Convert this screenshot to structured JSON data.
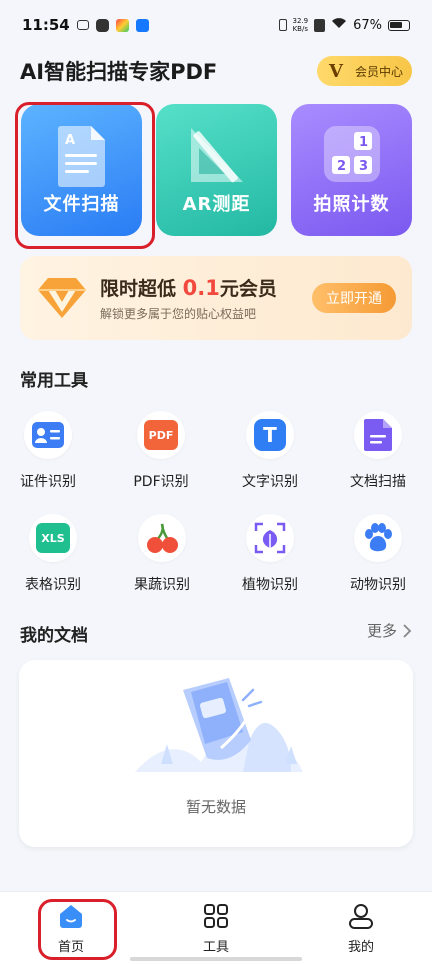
{
  "status_bar": {
    "time": "11:54",
    "net_top": "32.9",
    "net_bottom": "KB/s",
    "battery": "67%"
  },
  "header": {
    "title": "AI智能扫描专家PDF",
    "vip_letter": "V",
    "vip_label": "会员中心"
  },
  "tiles": [
    {
      "label": "文件扫描",
      "color": "#3a8ef8"
    },
    {
      "label": "AR测距",
      "color": "#2fc6b0"
    },
    {
      "label": "拍照计数",
      "color": "#8a6af6"
    }
  ],
  "promo": {
    "title_prefix": "限时超低",
    "title_value": "0.1",
    "title_suffix": "元会员",
    "subtitle": "解锁更多属于您的贴心权益吧",
    "button": "立即开通"
  },
  "tools_section": {
    "title": "常用工具",
    "items": [
      {
        "label": "证件识别",
        "icon": "id-card-icon"
      },
      {
        "label": "PDF识别",
        "icon": "pdf-icon",
        "icon_text": "PDF"
      },
      {
        "label": "文字识别",
        "icon": "text-t-icon",
        "icon_text": "T"
      },
      {
        "label": "文档扫描",
        "icon": "document-icon"
      },
      {
        "label": "表格识别",
        "icon": "xls-icon",
        "icon_text": "XLS"
      },
      {
        "label": "果蔬识别",
        "icon": "cherry-icon"
      },
      {
        "label": "植物识别",
        "icon": "leaf-icon"
      },
      {
        "label": "动物识别",
        "icon": "paw-icon"
      }
    ]
  },
  "docs_section": {
    "title": "我的文档",
    "more": "更多",
    "empty": "暂无数据"
  },
  "tabbar": [
    {
      "label": "首页",
      "icon": "home-icon",
      "active": true
    },
    {
      "label": "工具",
      "icon": "grid-icon",
      "active": false
    },
    {
      "label": "我的",
      "icon": "user-icon",
      "active": false
    }
  ],
  "colors": {
    "accent": "#3a8ef8",
    "highlight": "#d9202a",
    "promo_red": "#f2493f"
  }
}
